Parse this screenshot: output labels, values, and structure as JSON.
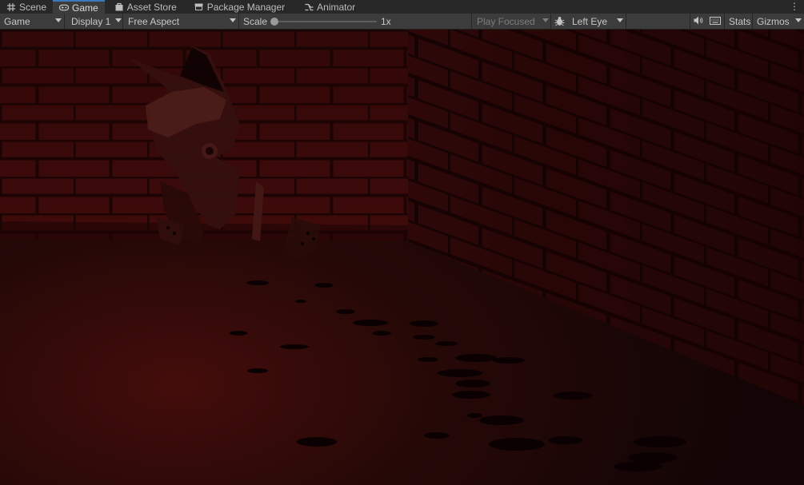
{
  "tabs": [
    {
      "label": "Scene",
      "icon": "grid-icon"
    },
    {
      "label": "Game",
      "icon": "gamepad-icon",
      "active": true
    },
    {
      "label": "Asset Store",
      "icon": "bag-icon"
    },
    {
      "label": "Package Manager",
      "icon": "package-icon"
    },
    {
      "label": "Animator",
      "icon": "animator-icon"
    }
  ],
  "toolbar": {
    "mode": "Game",
    "display": "Display 1",
    "aspect": "Free Aspect",
    "scale_label": "Scale",
    "scale_value": "1x",
    "scale_fraction": 0.0,
    "play_mode": "Play Focused",
    "eye": "Left Eye",
    "stats": "Stats",
    "gizmos": "Gizmos"
  },
  "colors": {
    "accent": "#3a79bb",
    "tab_bar": "#282828",
    "toolbar": "#3c3c3c",
    "scene_red": "#5a0b0b"
  }
}
